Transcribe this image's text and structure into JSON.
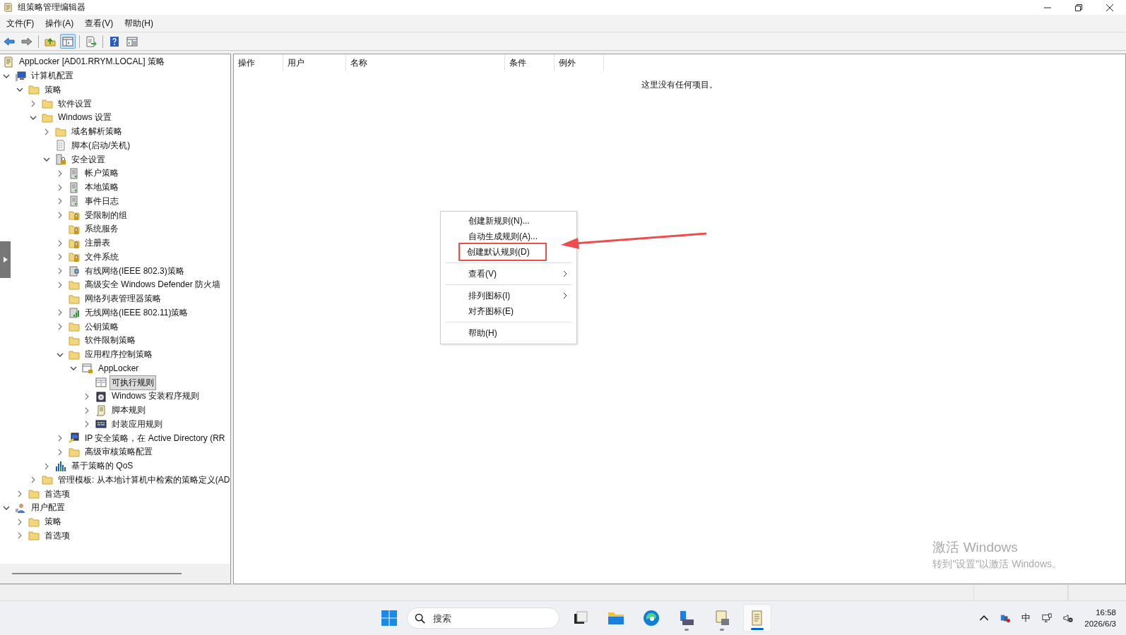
{
  "window": {
    "title": "组策略管理编辑器"
  },
  "menu_bar": [
    "文件(F)",
    "操作(A)",
    "查看(V)",
    "帮助(H)"
  ],
  "toolbar": [
    {
      "kind": "back",
      "pressed": false
    },
    {
      "kind": "forward",
      "pressed": false
    },
    {
      "kind": "up",
      "pressed": false
    },
    {
      "kind": "tree-toggle",
      "pressed": true
    },
    {
      "kind": "export",
      "pressed": false
    },
    {
      "kind": "help",
      "pressed": false
    },
    {
      "kind": "view",
      "pressed": false
    }
  ],
  "tree_root": {
    "label": "AppLocker [AD01.RRYM.LOCAL] 策略"
  },
  "tree": [
    {
      "label": "计算机配置",
      "kind": "computer",
      "expandable": true,
      "expanded": true,
      "selected": false,
      "children": [
        {
          "label": "策略",
          "kind": "folder",
          "expandable": true,
          "expanded": true,
          "selected": false,
          "children": [
            {
              "label": "软件设置",
              "kind": "folder",
              "expandable": true,
              "expanded": false,
              "selected": false
            },
            {
              "label": "Windows 设置",
              "kind": "folder",
              "expandable": true,
              "expanded": true,
              "selected": false,
              "children": [
                {
                  "label": "域名解析策略",
                  "kind": "folder",
                  "expandable": true,
                  "expanded": false,
                  "selected": false
                },
                {
                  "label": "脚本(启动/关机)",
                  "kind": "script",
                  "expandable": false,
                  "selected": false
                },
                {
                  "label": "安全设置",
                  "kind": "security",
                  "expandable": true,
                  "expanded": true,
                  "selected": false,
                  "children": [
                    {
                      "label": "帐户策略",
                      "kind": "server",
                      "expandable": true,
                      "expanded": false,
                      "selected": false
                    },
                    {
                      "label": "本地策略",
                      "kind": "server",
                      "expandable": true,
                      "expanded": false,
                      "selected": false
                    },
                    {
                      "label": "事件日志",
                      "kind": "server",
                      "expandable": true,
                      "expanded": false,
                      "selected": false
                    },
                    {
                      "label": "受限制的组",
                      "kind": "lockfolder",
                      "expandable": true,
                      "expanded": false,
                      "selected": false
                    },
                    {
                      "label": "系统服务",
                      "kind": "lockfolder",
                      "expandable": false,
                      "selected": false
                    },
                    {
                      "label": "注册表",
                      "kind": "lockfolder",
                      "expandable": true,
                      "expanded": false,
                      "selected": false
                    },
                    {
                      "label": "文件系统",
                      "kind": "lockfolder",
                      "expandable": true,
                      "expanded": false,
                      "selected": false
                    },
                    {
                      "label": "有线网络(IEEE 802.3)策略",
                      "kind": "network",
                      "expandable": true,
                      "expanded": false,
                      "selected": false
                    },
                    {
                      "label": "高级安全 Windows Defender 防火墙",
                      "kind": "folder",
                      "expandable": true,
                      "expanded": false,
                      "selected": false
                    },
                    {
                      "label": "网络列表管理器策略",
                      "kind": "folder",
                      "expandable": false,
                      "selected": false
                    },
                    {
                      "label": "无线网络(IEEE 802.11)策略",
                      "kind": "wireless",
                      "expandable": true,
                      "expanded": false,
                      "selected": false
                    },
                    {
                      "label": "公钥策略",
                      "kind": "folder",
                      "expandable": true,
                      "expanded": false,
                      "selected": false
                    },
                    {
                      "label": "软件限制策略",
                      "kind": "folder",
                      "expandable": false,
                      "selected": false
                    },
                    {
                      "label": "应用程序控制策略",
                      "kind": "folder",
                      "expandable": true,
                      "expanded": true,
                      "selected": false,
                      "children": [
                        {
                          "label": "AppLocker",
                          "kind": "applocker",
                          "expandable": true,
                          "expanded": true,
                          "selected": false,
                          "children": [
                            {
                              "label": "可执行规则",
                              "kind": "rules",
                              "expandable": false,
                              "selected": true
                            },
                            {
                              "label": "Windows 安装程序规则",
                              "kind": "installer",
                              "expandable": true,
                              "expanded": false,
                              "selected": false
                            },
                            {
                              "label": "脚本规则",
                              "kind": "scroll",
                              "expandable": true,
                              "expanded": false,
                              "selected": false
                            },
                            {
                              "label": "封装应用规则",
                              "kind": "package",
                              "expandable": true,
                              "expanded": false,
                              "selected": false
                            }
                          ]
                        }
                      ]
                    },
                    {
                      "label": "IP 安全策略，在 Active Directory (RR",
                      "kind": "ipsec",
                      "expandable": true,
                      "expanded": false,
                      "selected": false
                    },
                    {
                      "label": "高级审核策略配置",
                      "kind": "folder",
                      "expandable": true,
                      "expanded": false,
                      "selected": false
                    }
                  ]
                },
                {
                  "label": "基于策略的 QoS",
                  "kind": "qos",
                  "expandable": true,
                  "expanded": false,
                  "selected": false
                }
              ]
            },
            {
              "label": "管理模板: 从本地计算机中检索的策略定义(AD",
              "kind": "folder",
              "expandable": true,
              "expanded": false,
              "selected": false
            }
          ]
        },
        {
          "label": "首选项",
          "kind": "folder",
          "expandable": true,
          "expanded": false,
          "selected": false
        }
      ]
    },
    {
      "label": "用户配置",
      "kind": "user",
      "expandable": true,
      "expanded": true,
      "selected": false,
      "children": [
        {
          "label": "策略",
          "kind": "folder",
          "expandable": true,
          "expanded": false,
          "selected": false
        },
        {
          "label": "首选项",
          "kind": "folder",
          "expandable": true,
          "expanded": false,
          "selected": false
        }
      ]
    }
  ],
  "table": {
    "columns": [
      "操作",
      "用户",
      "名称",
      "条件",
      "例外"
    ],
    "empty_message": "这里没有任何项目。"
  },
  "context_menu": {
    "groups": [
      [
        {
          "label": "创建新规则(N)...",
          "submenu": false,
          "annotated": false
        },
        {
          "label": "自动生成规则(A)...",
          "submenu": false,
          "annotated": false
        },
        {
          "label": "创建默认规则(D)",
          "submenu": false,
          "annotated": true
        }
      ],
      [
        {
          "label": "查看(V)",
          "submenu": true,
          "annotated": false
        }
      ],
      [
        {
          "label": "排列图标(I)",
          "submenu": true,
          "annotated": false
        },
        {
          "label": "对齐图标(E)",
          "submenu": false,
          "annotated": false
        }
      ],
      [
        {
          "label": "帮助(H)",
          "submenu": false,
          "annotated": false
        }
      ]
    ]
  },
  "watermark": {
    "title": "激活 Windows",
    "subtitle": "转到\"设置\"以激活 Windows。"
  },
  "taskbar": {
    "search": {
      "placeholder": "搜索"
    },
    "apps": [
      {
        "kind": "task-view",
        "running": false,
        "active": false
      },
      {
        "kind": "explorer",
        "running": false,
        "active": false
      },
      {
        "kind": "edge",
        "running": false,
        "active": false
      },
      {
        "kind": "server-manager",
        "running": true,
        "active": false
      },
      {
        "kind": "gpmc",
        "running": true,
        "active": false
      },
      {
        "kind": "gpedit",
        "running": true,
        "active": true
      }
    ],
    "ime": "中",
    "time": "16:58",
    "date": "2026/6/3"
  }
}
